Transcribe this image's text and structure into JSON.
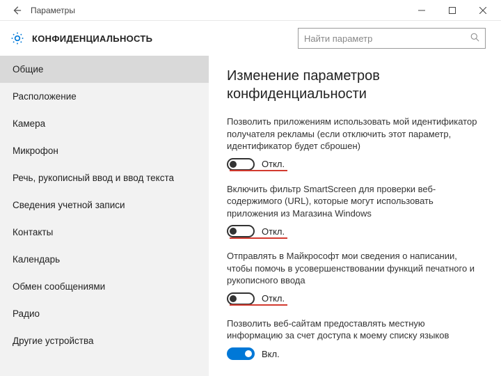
{
  "window": {
    "title": "Параметры"
  },
  "header": {
    "title": "КОНФИДЕНЦИАЛЬНОСТЬ",
    "search_placeholder": "Найти параметр"
  },
  "sidebar": {
    "items": [
      {
        "label": "Общие",
        "active": true
      },
      {
        "label": "Расположение",
        "active": false
      },
      {
        "label": "Камера",
        "active": false
      },
      {
        "label": "Микрофон",
        "active": false
      },
      {
        "label": "Речь, рукописный ввод и ввод текста",
        "active": false
      },
      {
        "label": "Сведения учетной записи",
        "active": false
      },
      {
        "label": "Контакты",
        "active": false
      },
      {
        "label": "Календарь",
        "active": false
      },
      {
        "label": "Обмен сообщениями",
        "active": false
      },
      {
        "label": "Радио",
        "active": false
      },
      {
        "label": "Другие устройства",
        "active": false
      }
    ]
  },
  "content": {
    "heading": "Изменение параметров конфиденциальности",
    "settings": [
      {
        "desc": "Позволить приложениям использовать мой идентификатор получателя рекламы (если отключить этот параметр, идентификатор будет сброшен)",
        "state": "off",
        "state_label": "Откл.",
        "emphasis": true
      },
      {
        "desc": "Включить фильтр SmartScreen для проверки веб-содержимого (URL), которые могут использовать приложения из Магазина Windows",
        "state": "off",
        "state_label": "Откл.",
        "emphasis": true
      },
      {
        "desc": "Отправлять в Майкрософт мои сведения о написании, чтобы помочь в усовершенствовании функций печатного и рукописного ввода",
        "state": "off",
        "state_label": "Откл.",
        "emphasis": true
      },
      {
        "desc": "Позволить веб-сайтам предоставлять местную информацию за счет доступа к моему списку языков",
        "state": "on",
        "state_label": "Вкл.",
        "emphasis": false
      }
    ]
  }
}
